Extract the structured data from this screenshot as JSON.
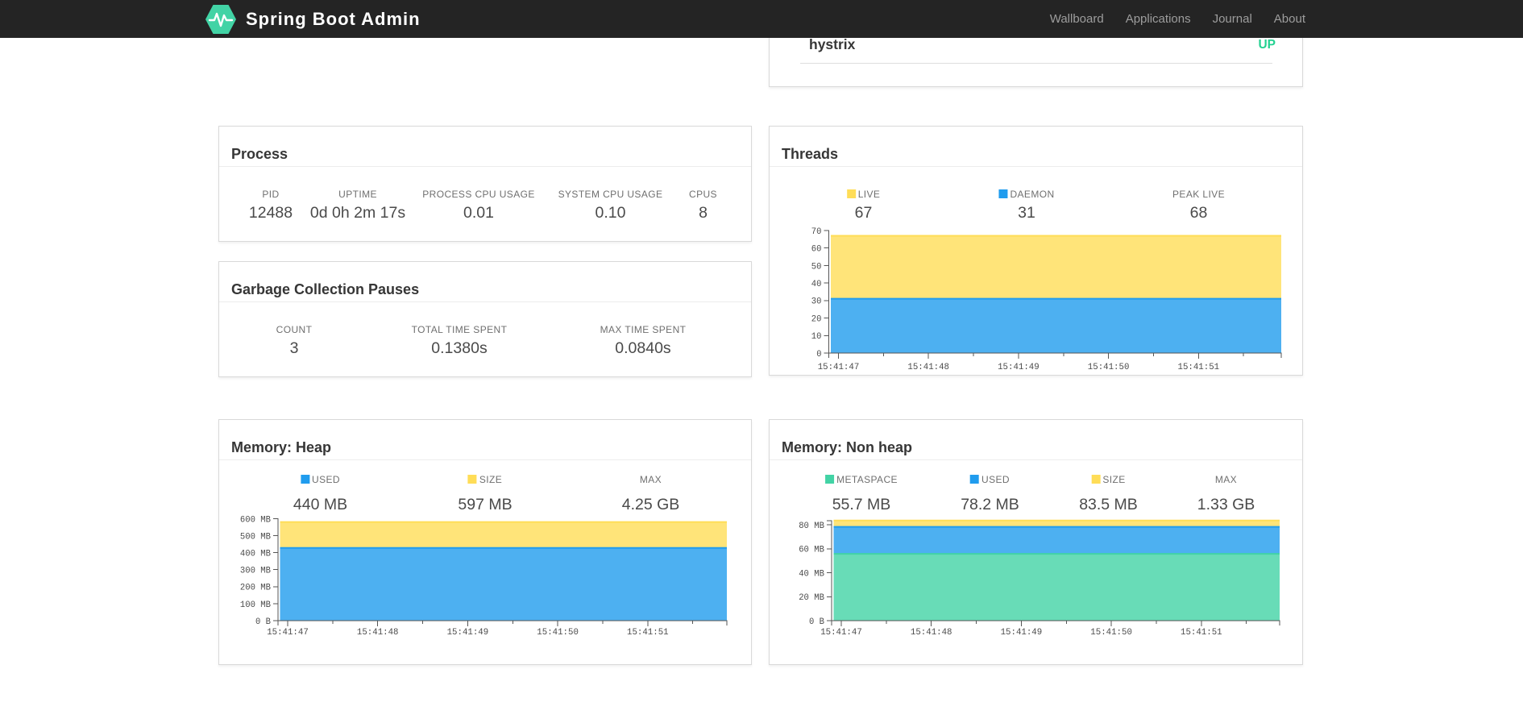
{
  "navbar": {
    "brand": "Spring Boot Admin",
    "items": [
      {
        "label": "Wallboard"
      },
      {
        "label": "Applications"
      },
      {
        "label": "Journal"
      },
      {
        "label": "About"
      }
    ]
  },
  "applications": {
    "rows": [
      {
        "name": "hystrix",
        "status": "UP"
      }
    ]
  },
  "status_colors": {
    "UP": "#23d191"
  },
  "cards": {
    "process": {
      "title": "Process",
      "metrics": [
        {
          "label": "PID",
          "value": "12488"
        },
        {
          "label": "UPTIME",
          "value": "0d 0h 2m 17s"
        },
        {
          "label": "PROCESS CPU USAGE",
          "value": "0.01"
        },
        {
          "label": "SYSTEM CPU USAGE",
          "value": "0.10"
        },
        {
          "label": "CPUS",
          "value": "8"
        }
      ]
    },
    "gc": {
      "title": "Garbage Collection Pauses",
      "metrics": [
        {
          "label": "COUNT",
          "value": "3"
        },
        {
          "label": "TOTAL TIME SPENT",
          "value": "0.1380s"
        },
        {
          "label": "MAX TIME SPENT",
          "value": "0.0840s"
        }
      ]
    },
    "threads": {
      "title": "Threads",
      "metrics": [
        {
          "label": "LIVE",
          "value": "67",
          "color": "#ffdd57"
        },
        {
          "label": "DAEMON",
          "value": "31",
          "color": "#209cee"
        },
        {
          "label": "PEAK LIVE",
          "value": "68"
        }
      ]
    },
    "heap": {
      "title": "Memory: Heap",
      "metrics": [
        {
          "label": "USED",
          "value": "440 MB",
          "color": "#209cee"
        },
        {
          "label": "SIZE",
          "value": "597 MB",
          "color": "#ffdd57"
        },
        {
          "label": "MAX",
          "value": "4.25 GB"
        }
      ]
    },
    "nonheap": {
      "title": "Memory: Non heap",
      "metrics": [
        {
          "label": "METASPACE",
          "value": "55.7 MB",
          "color": "#42d3a5"
        },
        {
          "label": "USED",
          "value": "78.2 MB",
          "color": "#209cee"
        },
        {
          "label": "SIZE",
          "value": "83.5 MB",
          "color": "#ffdd57"
        },
        {
          "label": "MAX",
          "value": "1.33 GB"
        }
      ]
    }
  },
  "chart_data": [
    {
      "id": "threads",
      "type": "area",
      "stacked": true,
      "title": "Threads",
      "x_ticks": [
        "15:41:47",
        "15:41:48",
        "15:41:49",
        "15:41:50",
        "15:41:51"
      ],
      "y_tick_values": [
        70,
        60,
        50,
        40,
        30,
        20,
        10,
        0
      ],
      "y_tick_labels": [
        "70",
        "60",
        "50",
        "40",
        "30",
        "20",
        "10",
        "0"
      ],
      "ylim": [
        0,
        70
      ],
      "series": [
        {
          "name": "LIVE",
          "value": 67,
          "color": "#ffdd57"
        },
        {
          "name": "DAEMON",
          "value": 31,
          "color": "#209cee"
        }
      ]
    },
    {
      "id": "heap",
      "type": "area",
      "stacked": false,
      "title": "Memory: Heap",
      "x_ticks": [
        "15:41:47",
        "15:41:48",
        "15:41:49",
        "15:41:50",
        "15:41:51"
      ],
      "y_tick_values": [
        600,
        500,
        400,
        300,
        200,
        100,
        0
      ],
      "y_tick_labels": [
        "600 MB",
        "500 MB",
        "400 MB",
        "300 MB",
        "200 MB",
        "100 MB",
        "0 B"
      ],
      "ylim": [
        0,
        600
      ],
      "series": [
        {
          "name": "SIZE",
          "value": 597,
          "color": "#ffdd57"
        },
        {
          "name": "USED",
          "value": 440,
          "color": "#209cee"
        }
      ]
    },
    {
      "id": "nonheap",
      "type": "area",
      "stacked": false,
      "title": "Memory: Non heap",
      "x_ticks": [
        "15:41:47",
        "15:41:48",
        "15:41:49",
        "15:41:50",
        "15:41:51"
      ],
      "y_tick_values": [
        80,
        60,
        40,
        20,
        0
      ],
      "y_tick_labels": [
        "80 MB",
        "60 MB",
        "40 MB",
        "20 MB",
        "0 B"
      ],
      "ylim": [
        0,
        80
      ],
      "series": [
        {
          "name": "SIZE",
          "value": 83.5,
          "color": "#ffdd57"
        },
        {
          "name": "USED",
          "value": 78.2,
          "color": "#209cee"
        },
        {
          "name": "METASPACE",
          "value": 55.7,
          "color": "#42d3a5"
        }
      ]
    }
  ]
}
